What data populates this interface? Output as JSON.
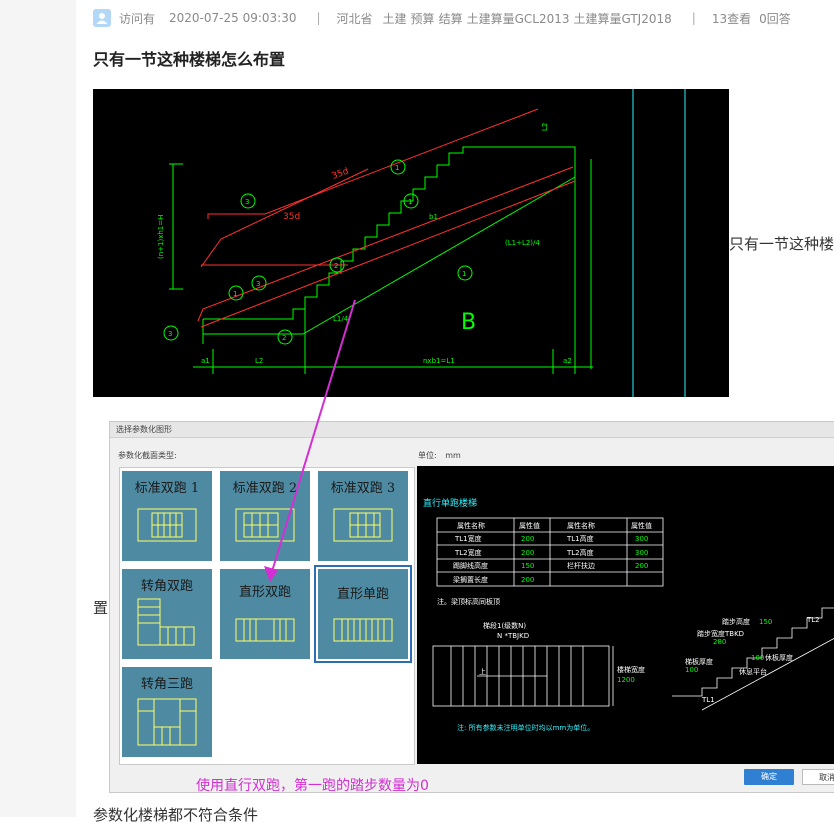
{
  "meta": {
    "author": "访问有",
    "datetime": "2020-07-25 09:03:30",
    "region": "河北省",
    "tags": [
      "土建",
      "预算",
      "结算",
      "土建算量GCL2013",
      "土建算量GTJ2018"
    ],
    "views": "13查看",
    "answers": "0回答",
    "sep": "|"
  },
  "question": {
    "title": "只有一节这种楼梯怎么布置",
    "side_text": "只有一节这种楼",
    "side_text2": "置",
    "bottom_text": "参数化楼梯都不符合条件"
  },
  "cad1": {
    "labels": {
      "t35d_top": "35d",
      "t35d_mid": "35d",
      "tb1": "b1",
      "tl1": "L1/4",
      "tl1l2": "(L1+L2)/4",
      "ta1": "a1",
      "ta2": "a2",
      "tL2": "L2",
      "tnb": "nxb1=L1",
      "tB": "B",
      "tl2v": "L2",
      "th": "(n+1)xh1=H",
      "c1": "1",
      "c2": "2",
      "c3": "3"
    }
  },
  "dialog": {
    "title": "选择参数化图形",
    "section_label": "参数化截面类型:",
    "unit_label": "单位:",
    "unit_value": "mm",
    "tiles": [
      {
        "label": "标准双跑 1"
      },
      {
        "label": "标准双跑 2"
      },
      {
        "label": "标准双跑 3"
      },
      {
        "label": "转角双跑"
      },
      {
        "label": "直形双跑"
      },
      {
        "label": "直形单跑"
      },
      {
        "label": "转角三跑"
      }
    ],
    "ok": "确定",
    "cancel": "取消"
  },
  "preview": {
    "title": "直行单跑楼梯",
    "table_header": [
      "属性名称",
      "属性值",
      "属性名称",
      "属性值"
    ],
    "table_rows": [
      [
        "TL1宽度",
        "200",
        "TL1高度",
        "300"
      ],
      [
        "TL2宽度",
        "200",
        "TL2高度",
        "300"
      ],
      [
        "踢脚线高度",
        "150",
        "栏杆扶边",
        "200"
      ],
      [
        "梁搁置长度",
        "200",
        "",
        ""
      ]
    ],
    "note": "注。梁顶标高同板顶",
    "lbl_tb": "梯段1(级数N)",
    "lbl_n": "N *TBJKD",
    "lbl_width": "楼梯宽度",
    "lbl_width_val": "1200",
    "lbl_up": "上",
    "lbl_stepH": "踏步高度",
    "lbl_stepH_val": "150",
    "lbl_stepW": "踏步宽度TBKD",
    "lbl_stepW_val": "280",
    "lbl_slab": "梯板厚度",
    "lbl_slab_val": "100",
    "lbl_plate": "休息平台",
    "lbl_plate_val": "100",
    "lbl_slabd": "休板厚度",
    "lbl_tl2": "TL2",
    "lbl_tl1": "TL1",
    "footnote": "注: 所有参数未注明单位时均以mm为单位。"
  },
  "annotation": "使用直行双跑，第一跑的踏步数量为0",
  "colors": {
    "cad_green": "#00ff00",
    "cad_red": "#ff3030",
    "cad_cyan": "#2ef4ff",
    "tile_bg": "#4e8aa1",
    "annotation": "#d42ed4",
    "primary_button": "#2f7fd3"
  }
}
